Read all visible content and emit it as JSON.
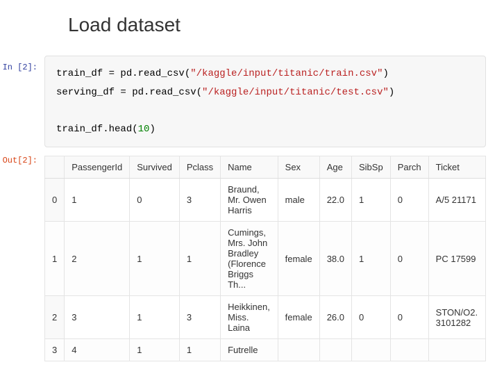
{
  "heading": "Load dataset",
  "input_cell": {
    "prompt": "In [2]:",
    "code": {
      "line1_pre": "train_df = pd.read_csv(",
      "line1_str": "\"/kaggle/input/titanic/train.csv\"",
      "line1_post": ")",
      "line2_pre": "serving_df = pd.read_csv(",
      "line2_str": "\"/kaggle/input/titanic/test.csv\"",
      "line2_post": ")",
      "line3_pre": "train_df.head(",
      "line3_num": "10",
      "line3_post": ")"
    }
  },
  "output_cell": {
    "prompt": "Out[2]:",
    "columns": [
      "PassengerId",
      "Survived",
      "Pclass",
      "Name",
      "Sex",
      "Age",
      "SibSp",
      "Parch",
      "Ticket"
    ],
    "rows": [
      {
        "idx": "0",
        "PassengerId": "1",
        "Survived": "0",
        "Pclass": "3",
        "Name": "Braund, Mr. Owen Harris",
        "Sex": "male",
        "Age": "22.0",
        "SibSp": "1",
        "Parch": "0",
        "Ticket": "A/5 21171"
      },
      {
        "idx": "1",
        "PassengerId": "2",
        "Survived": "1",
        "Pclass": "1",
        "Name": "Cumings, Mrs. John Bradley (Florence Briggs Th...",
        "Sex": "female",
        "Age": "38.0",
        "SibSp": "1",
        "Parch": "0",
        "Ticket": "PC 17599"
      },
      {
        "idx": "2",
        "PassengerId": "3",
        "Survived": "1",
        "Pclass": "3",
        "Name": "Heikkinen, Miss. Laina",
        "Sex": "female",
        "Age": "26.0",
        "SibSp": "0",
        "Parch": "0",
        "Ticket": "STON/O2. 3101282"
      },
      {
        "idx": "3",
        "PassengerId": "4",
        "Survived": "1",
        "Pclass": "1",
        "Name": "Futrelle",
        "Sex": "",
        "Age": "",
        "SibSp": "",
        "Parch": "",
        "Ticket": ""
      }
    ]
  }
}
